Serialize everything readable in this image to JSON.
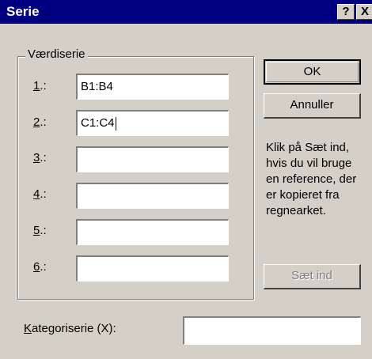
{
  "window": {
    "title": "Serie",
    "help_button": "?",
    "close_button": "X"
  },
  "value_series": {
    "group_label": "Værdiserie",
    "rows": [
      {
        "hotkey": "1",
        "suffix": ".:",
        "value": "B1:B4"
      },
      {
        "hotkey": "2",
        "suffix": ".:",
        "value": "C1:C4"
      },
      {
        "hotkey": "3",
        "suffix": ".:",
        "value": ""
      },
      {
        "hotkey": "4",
        "suffix": ".:",
        "value": ""
      },
      {
        "hotkey": "5",
        "suffix": ".:",
        "value": ""
      },
      {
        "hotkey": "6",
        "suffix": ".:",
        "value": ""
      }
    ]
  },
  "buttons": {
    "ok": "OK",
    "cancel": "Annuller",
    "paste": "Sæt ind"
  },
  "help_text": "Klik på Sæt ind, hvis du vil bruge en reference, der er kopieret fra regnearket.",
  "category_series": {
    "hotkey": "K",
    "label_rest": "ategoriserie (X):",
    "value": ""
  }
}
